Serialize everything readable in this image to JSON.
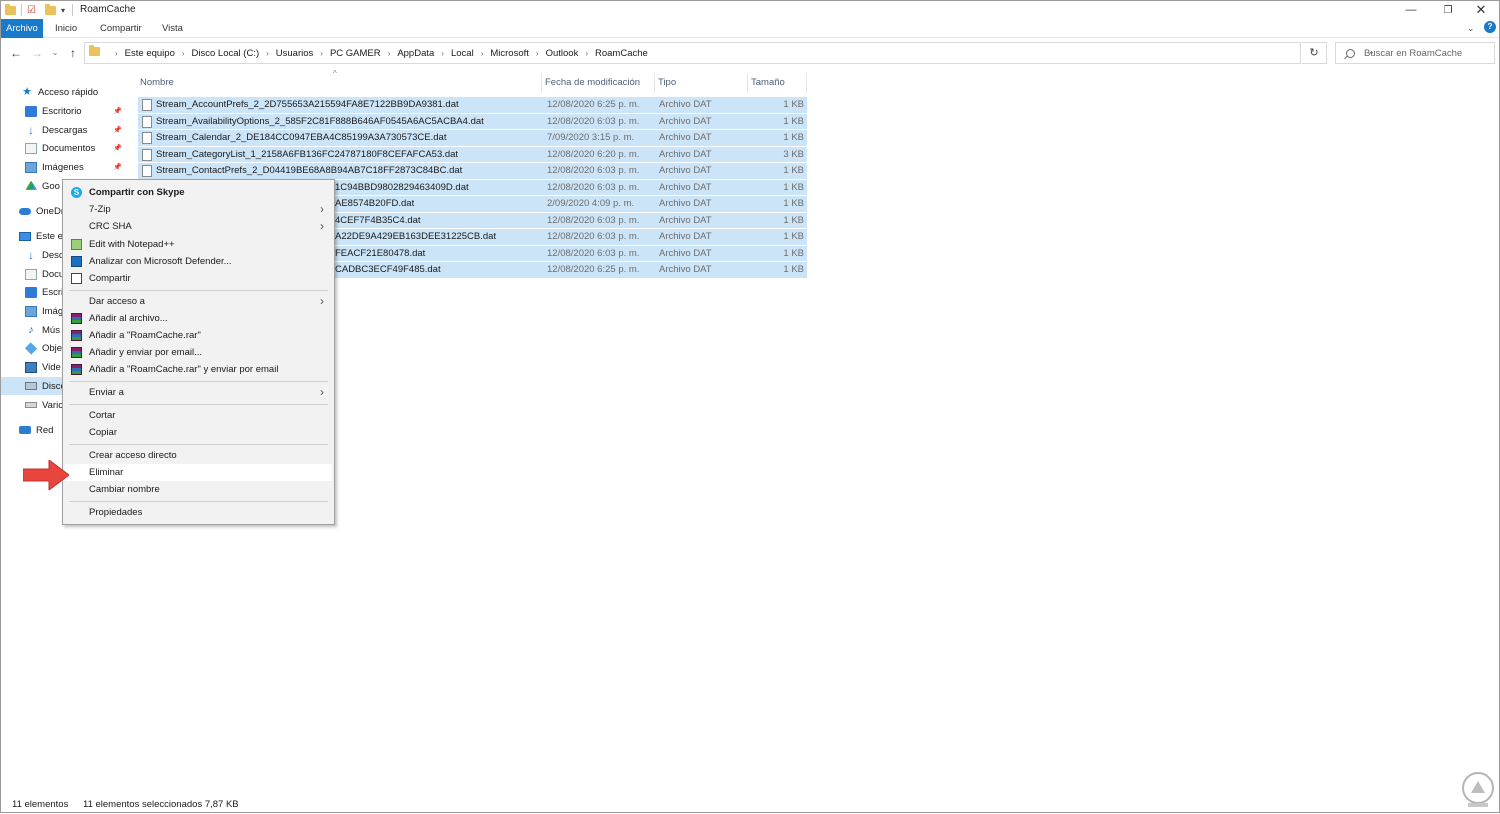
{
  "window": {
    "title": "RoamCache"
  },
  "ribbon": {
    "tabs": [
      "Archivo",
      "Inicio",
      "Compartir",
      "Vista"
    ]
  },
  "address": {
    "crumbs": [
      "Este equipo",
      "Disco Local (C:)",
      "Usuarios",
      "PC GAMER",
      "AppData",
      "Local",
      "Microsoft",
      "Outlook",
      "RoamCache"
    ]
  },
  "search": {
    "placeholder": "Buscar en RoamCache"
  },
  "sidebar": {
    "items": [
      {
        "label": "Acceso rápido",
        "icon": "star-icon"
      },
      {
        "label": "Escritorio",
        "icon": "desktop-icon",
        "pinned": true
      },
      {
        "label": "Descargas",
        "icon": "download-icon",
        "pinned": true
      },
      {
        "label": "Documentos",
        "icon": "documents-icon",
        "pinned": true
      },
      {
        "label": "Imágenes",
        "icon": "pictures-icon",
        "pinned": true
      },
      {
        "label": "Goo",
        "icon": "google-drive-icon"
      },
      {
        "label": "OneDri",
        "icon": "onedrive-icon"
      },
      {
        "label": "Este e",
        "icon": "this-pc-icon"
      },
      {
        "label": "Desc",
        "icon": "download-icon"
      },
      {
        "label": "Docu",
        "icon": "documents-icon"
      },
      {
        "label": "Escri",
        "icon": "desktop-icon"
      },
      {
        "label": "Imág",
        "icon": "pictures-icon"
      },
      {
        "label": "Mús",
        "icon": "music-icon"
      },
      {
        "label": "Obje",
        "icon": "3d-objects-icon"
      },
      {
        "label": "Vide",
        "icon": "videos-icon"
      },
      {
        "label": "Disco",
        "icon": "disk-icon",
        "selected": true
      },
      {
        "label": "Varic",
        "icon": "usb-drive-icon"
      },
      {
        "label": "Red",
        "icon": "network-icon"
      }
    ]
  },
  "columns": {
    "name": "Nombre",
    "date": "Fecha de modificación",
    "type": "Tipo",
    "size": "Tamaño"
  },
  "files": [
    {
      "name": "Stream_AccountPrefs_2_2D755653A215594FA8E7122BB9DA9381.dat",
      "date": "12/08/2020 6:25 p. m.",
      "type": "Archivo DAT",
      "size": "1 KB"
    },
    {
      "name": "Stream_AvailabilityOptions_2_585F2C81F888B646AF0545A6AC5ACBA4.dat",
      "date": "12/08/2020 6:03 p. m.",
      "type": "Archivo DAT",
      "size": "1 KB"
    },
    {
      "name": "Stream_Calendar_2_DE184CC0947EBA4C85199A3A730573CE.dat",
      "date": "7/09/2020 3:15 p. m.",
      "type": "Archivo DAT",
      "size": "1 KB"
    },
    {
      "name": "Stream_CategoryList_1_2158A6FB136FC24787180F8CEFAFCA53.dat",
      "date": "12/08/2020 6:20 p. m.",
      "type": "Archivo DAT",
      "size": "3 KB"
    },
    {
      "name": "Stream_ContactPrefs_2_D04419BE68A8B94AB7C18FF2873C84BC.dat",
      "date": "12/08/2020 6:03 p. m.",
      "type": "Archivo DAT",
      "size": "1 KB"
    },
    {
      "name": "1C94BBD9802829463409D.dat",
      "date": "12/08/2020 6:03 p. m.",
      "type": "Archivo DAT",
      "size": "1 KB"
    },
    {
      "name": "AE8574B20FD.dat",
      "date": "2/09/2020 4:09 p. m.",
      "type": "Archivo DAT",
      "size": "1 KB"
    },
    {
      "name": "4CEF7F4B35C4.dat",
      "date": "12/08/2020 6:03 p. m.",
      "type": "Archivo DAT",
      "size": "1 KB"
    },
    {
      "name": "A22DE9A429EB163DEE31225CB.dat",
      "date": "12/08/2020 6:03 p. m.",
      "type": "Archivo DAT",
      "size": "1 KB"
    },
    {
      "name": "FEACF21E80478.dat",
      "date": "12/08/2020 6:03 p. m.",
      "type": "Archivo DAT",
      "size": "1 KB"
    },
    {
      "name": "CADBC3ECF49F485.dat",
      "date": "12/08/2020 6:25 p. m.",
      "type": "Archivo DAT",
      "size": "1 KB"
    }
  ],
  "context_menu": {
    "skype": "Compartir con Skype",
    "zip": "7-Zip",
    "crc": "CRC SHA",
    "notepad": "Edit with Notepad++",
    "defender": "Analizar con Microsoft Defender...",
    "share": "Compartir",
    "grant_access": "Dar acceso a",
    "add_archive": "Añadir al archivo...",
    "add_rar": "Añadir a \"RoamCache.rar\"",
    "add_email": "Añadir y enviar por email...",
    "add_rar_email": "Añadir a \"RoamCache.rar\" y enviar por email",
    "send_to": "Enviar a",
    "cut": "Cortar",
    "copy": "Copiar",
    "shortcut": "Crear acceso directo",
    "delete": "Eliminar",
    "rename": "Cambiar nombre",
    "properties": "Propiedades"
  },
  "status": {
    "count": "11 elementos",
    "selected": "11 elementos seleccionados  7,87 KB"
  },
  "colors": {
    "accent": "#1979ca",
    "selection": "#cce4f7",
    "arrow": "#e8453c"
  }
}
